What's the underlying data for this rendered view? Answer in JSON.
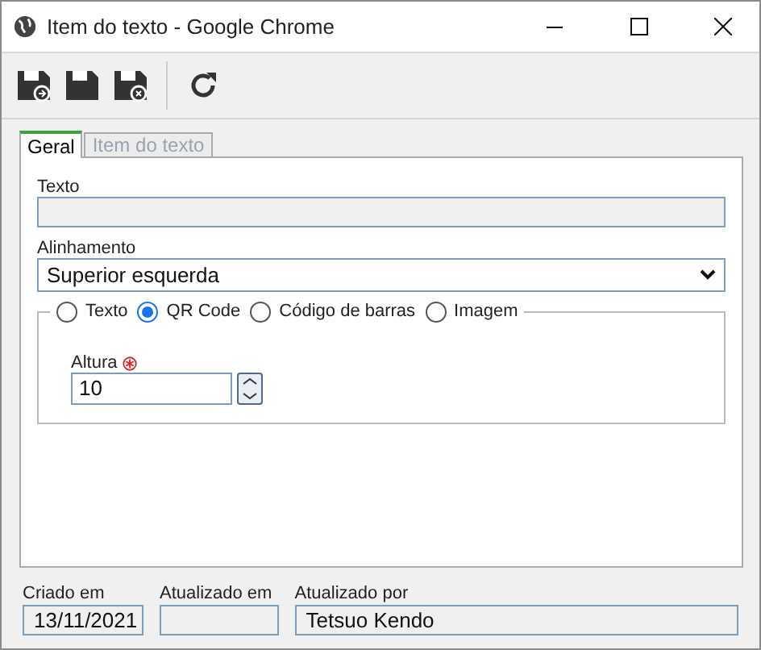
{
  "window": {
    "title": "Item do texto - Google Chrome"
  },
  "tabs": [
    {
      "label": "Geral",
      "selected": true
    },
    {
      "label": "Item do texto",
      "selected": false
    }
  ],
  "texto": {
    "label": "Texto",
    "disabled": true
  },
  "alinhamento": {
    "label": "Alinhamento",
    "value": "Superior esquerda"
  },
  "tipo": [
    {
      "label": "Texto",
      "selected": false
    },
    {
      "label": "QR Code",
      "selected": true
    },
    {
      "label": "Código de barras",
      "selected": false
    },
    {
      "label": "Imagem",
      "selected": false
    }
  ],
  "altura": {
    "label": "Altura",
    "required": true,
    "value": "10"
  },
  "footer": [
    {
      "label": "Criado em",
      "value": "13/11/2021"
    },
    {
      "label": "Atualizado em"
    },
    {
      "label": "Atualizado por",
      "value": "Tetsuo Kendo"
    }
  ]
}
